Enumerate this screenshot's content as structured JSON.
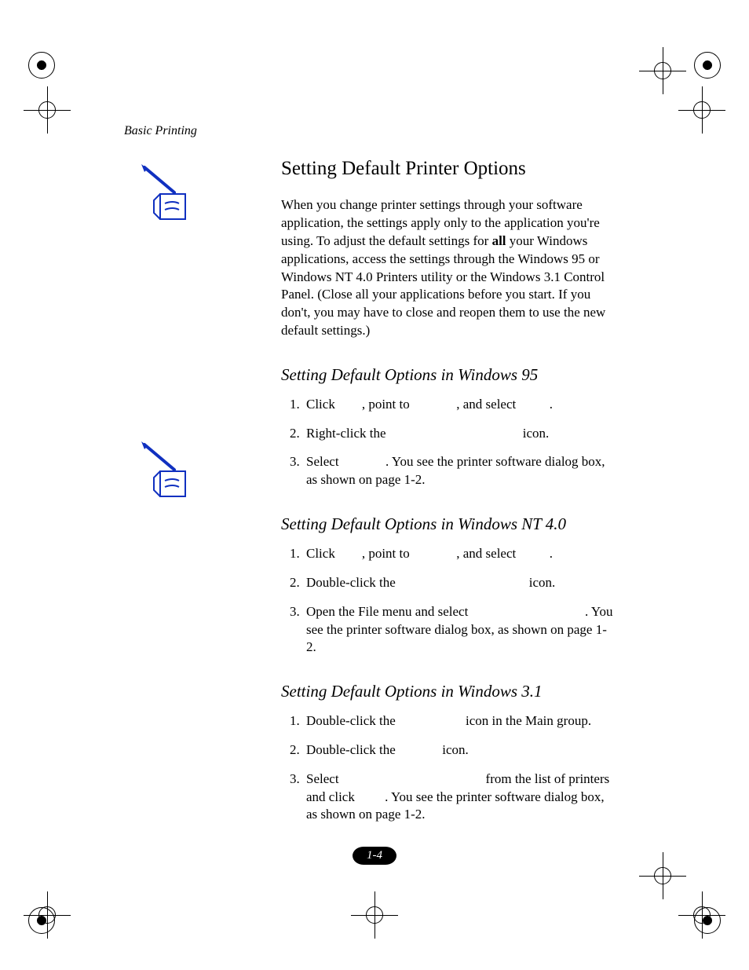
{
  "running_header": "Basic Printing",
  "title": "Setting Default Printer Options",
  "intro_a": "When you change printer settings through your software application, the settings apply only to the application you're using. To adjust the default settings for ",
  "intro_bold": "all",
  "intro_b": " your Windows applications, access the settings through the Windows 95 or Windows NT 4.0 Printers utility or the Windows 3.1 Control Panel. (Close all your applications before you start. If you don't, you may have to close and reopen them to use the new default settings.)",
  "sections": {
    "w95": {
      "heading": "Setting Default Options in Windows 95",
      "items": [
        "Click        , point to              , and select          .",
        "Right-click the                                         icon.",
        "Select              . You see the printer software dialog box, as shown on page 1-2."
      ]
    },
    "wnt": {
      "heading": "Setting Default Options in Windows NT 4.0",
      "items": [
        "Click        , point to              , and select          .",
        "Double-click the                                        icon.",
        "Open the File menu and select                                   . You see the printer software dialog box, as shown on page 1-2."
      ]
    },
    "w31": {
      "heading": "Setting Default Options in Windows 3.1",
      "items": [
        "Double-click the                     icon in the Main group.",
        "Double-click the              icon.",
        "Select                                            from the list of printers and click         . You see the printer software dialog box, as shown on page 1-2."
      ]
    }
  },
  "page_number": "1-4"
}
